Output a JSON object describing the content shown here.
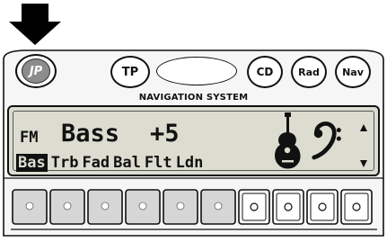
{
  "header": {
    "arrow_icon": "down-arrow-icon"
  },
  "buttons": {
    "power_icon": "jp-logo-icon",
    "tp_label": "TP",
    "cd_label": "CD",
    "rad_label": "Rad",
    "nav_label": "Nav"
  },
  "brand_label": "NAVIGATION SYSTEM",
  "display": {
    "band": "FM",
    "setting_name": "Bass",
    "setting_value": "+5",
    "menu_items": [
      "Bas",
      "Trb",
      "Fad",
      "Bal",
      "Flt",
      "Ldn"
    ],
    "selected_menu_index": 0,
    "icons": [
      "guitar-icon",
      "bass-clef-icon",
      "scroll-up-icon",
      "scroll-down-icon"
    ]
  },
  "colors": {
    "outline": "#111111",
    "lcd_background": "#dcdcd0",
    "faceplate": "#f4f4f4",
    "preset_shaded": "#d6d6d6"
  }
}
